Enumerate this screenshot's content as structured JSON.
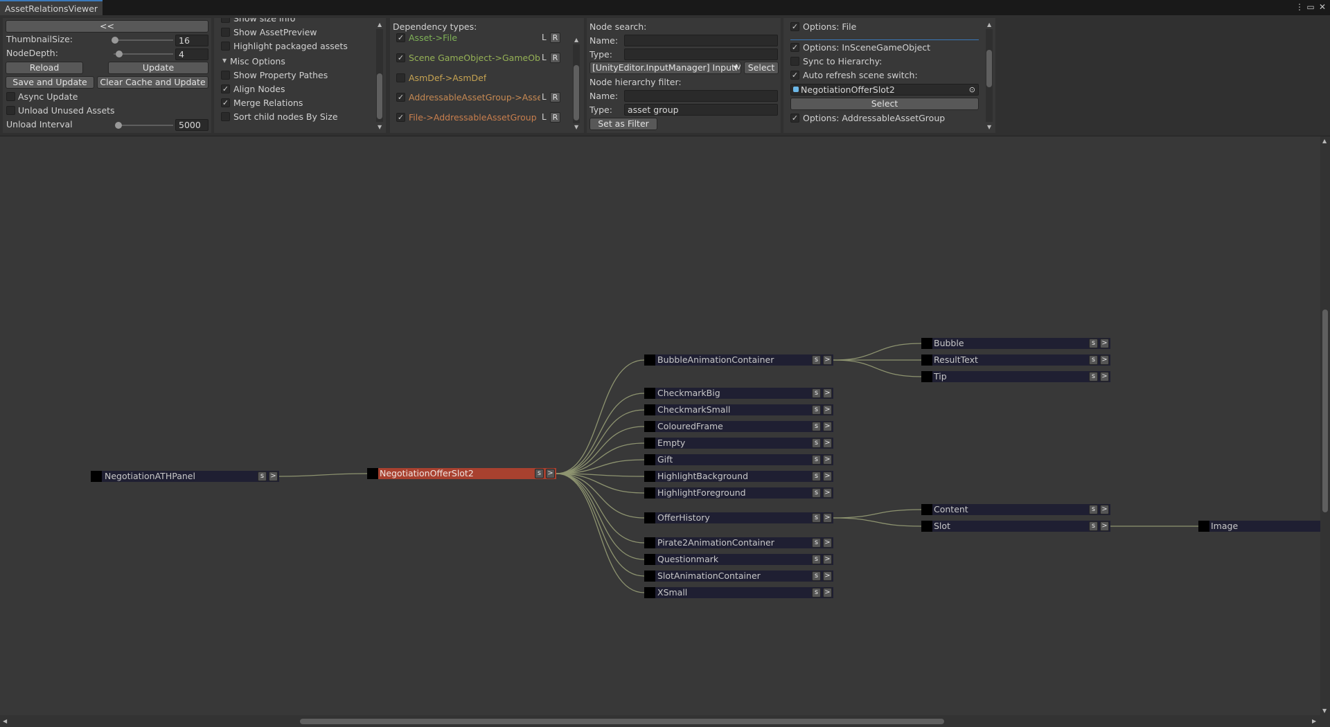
{
  "window": {
    "tab_title": "AssetRelationsViewer",
    "menu_icon": "kebab-menu-icon",
    "maximize_icon": "maximize-icon",
    "close_icon": "close-icon"
  },
  "settings": {
    "collapse_label": "<<",
    "thumbnail_size_label": "ThumbnailSize:",
    "thumbnail_size_value": "16",
    "node_depth_label": "NodeDepth:",
    "node_depth_value": "4",
    "reload_label": "Reload",
    "update_label": "Update",
    "save_update_label": "Save and Update",
    "clear_cache_label": "Clear Cache and Update",
    "async_update_label": "Async Update",
    "async_update_checked": false,
    "unload_unused_label": "Unload Unused Assets",
    "unload_unused_checked": false,
    "unload_interval_label": "Unload Interval",
    "unload_interval_value": "5000"
  },
  "display_options": {
    "show_size_info": "Show size info",
    "show_asset_preview": "Show AssetPreview",
    "highlight_packaged": "Highlight packaged assets",
    "misc_header": "Misc Options",
    "show_property_pathes": "Show Property Pathes",
    "align_nodes": "Align Nodes",
    "merge_relations": "Merge Relations",
    "sort_child_nodes": "Sort child nodes By Size"
  },
  "dependency_types": {
    "header": "Dependency types:",
    "items": [
      {
        "label": "Asset->File",
        "checked": true,
        "color": "#7fb257"
      },
      {
        "label": "Scene GameObject->GameObject",
        "checked": true,
        "color": "#96b256"
      },
      {
        "label": "AsmDef->AsmDef",
        "checked": false,
        "color": "#c6a352"
      },
      {
        "label": "AddressableAssetGroup->Asset",
        "checked": true,
        "color": "#c78a53"
      },
      {
        "label": "File->AddressableAssetGroup",
        "checked": true,
        "color": "#c97f4e"
      }
    ],
    "l_label": "L",
    "r_label": "R"
  },
  "node_search": {
    "header": "Node search:",
    "name_label": "Name:",
    "name_value": "",
    "type_label": "Type:",
    "type_value": "",
    "dropdown_value": "[UnityEditor.InputManager] InputMa",
    "select_label": "Select",
    "hierarchy_header": "Node hierarchy filter:",
    "h_name_label": "Name:",
    "h_name_value": "",
    "h_type_label": "Type:",
    "h_type_value": "asset group",
    "set_filter_label": "Set as Filter"
  },
  "options": {
    "file_label": "Options: File",
    "in_scene_label": "Options: InSceneGameObject",
    "sync_label": "Sync to Hierarchy:",
    "auto_refresh_label": "Auto refresh scene switch:",
    "object_field_value": "NegotiationOfferSlot2",
    "select_label": "Select",
    "addressable_label": "Options: AddressableAssetGroup"
  },
  "graph": {
    "s_label": "s",
    "expand_label": ">",
    "root": "NegotiationATHPanel",
    "selected": "NegotiationOfferSlot2",
    "children": [
      "BubbleAnimationContainer",
      "CheckmarkBig",
      "CheckmarkSmall",
      "ColouredFrame",
      "Empty",
      "Gift",
      "HighlightBackground",
      "HighlightForeground",
      "OfferHistory",
      "Pirate2AnimationContainer",
      "Questionmark",
      "SlotAnimationContainer",
      "XSmall"
    ],
    "bubble_children": [
      "Bubble",
      "ResultText",
      "Tip"
    ],
    "history_children": [
      "Content",
      "Slot"
    ],
    "slot_children": [
      "Image"
    ]
  }
}
